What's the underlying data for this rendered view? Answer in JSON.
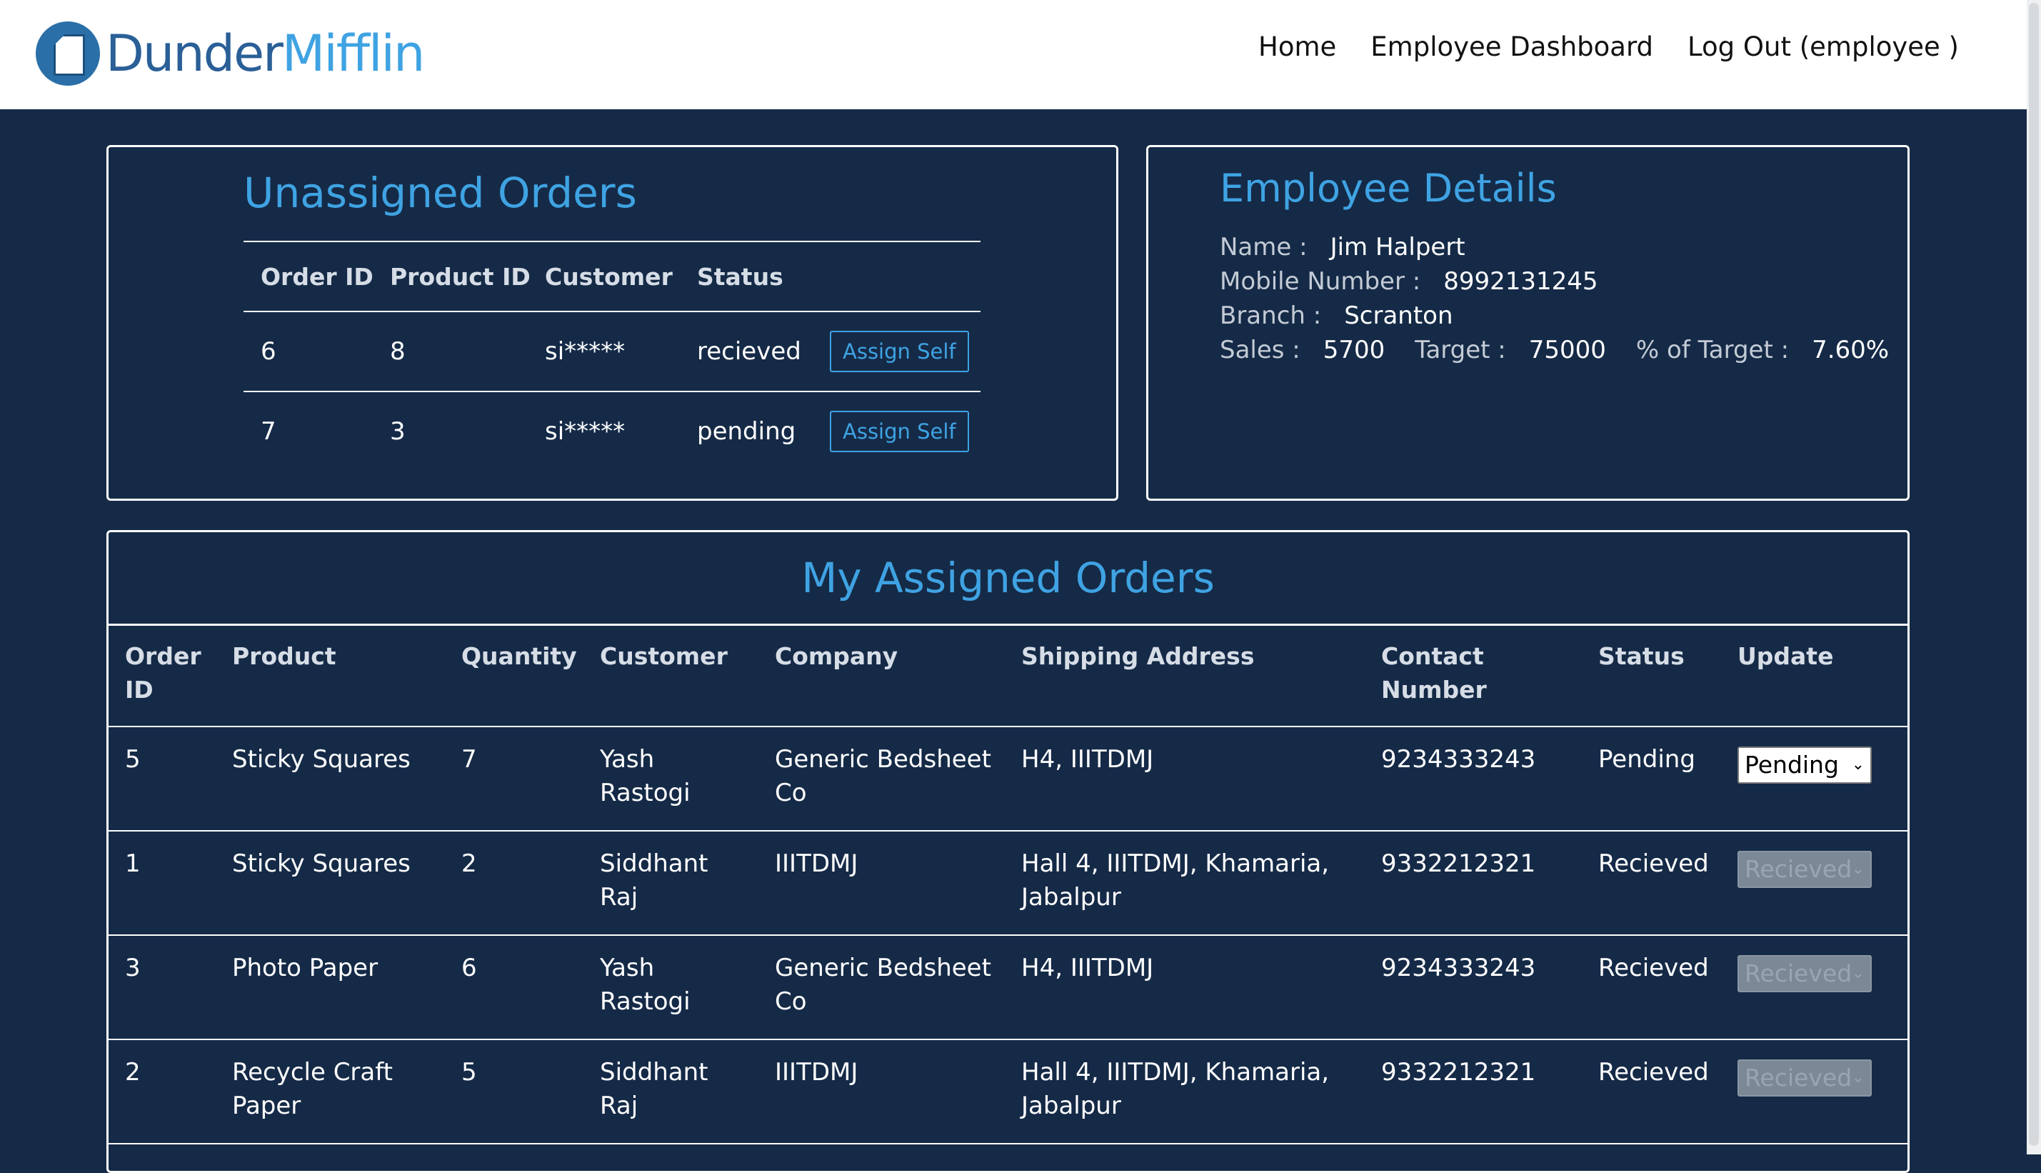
{
  "brand": {
    "part1": "Dunder",
    "part2": "Mifflin"
  },
  "nav": {
    "home": "Home",
    "dashboard": "Employee Dashboard",
    "logout": "Log Out (employee )"
  },
  "unassigned": {
    "title": "Unassigned Orders",
    "headers": [
      "Order ID",
      "Product ID",
      "Customer",
      "Status"
    ],
    "button_label": "Assign Self",
    "rows": [
      {
        "order_id": "6",
        "product_id": "8",
        "customer": "si*****",
        "status": "recieved"
      },
      {
        "order_id": "7",
        "product_id": "3",
        "customer": "si*****",
        "status": "pending"
      }
    ]
  },
  "employee": {
    "title": "Employee Details",
    "name_label": "Name :",
    "name": "Jim Halpert",
    "mobile_label": "Mobile Number :",
    "mobile": "8992131245",
    "branch_label": "Branch :",
    "branch": "Scranton",
    "sales_label": "Sales :",
    "sales": "5700",
    "target_label": "Target :",
    "target": "75000",
    "pct_label": "% of Target :",
    "pct": "7.60%"
  },
  "assigned": {
    "title": "My Assigned Orders",
    "headers": {
      "order_id_1": "Order",
      "order_id_2": "ID",
      "product": "Product",
      "quantity": "Quantity",
      "customer": "Customer",
      "company": "Company",
      "address": "Shipping Address",
      "contact_1": "Contact",
      "contact_2": "Number",
      "status": "Status",
      "update": "Update"
    },
    "rows": [
      {
        "order_id": "5",
        "product_1": "Sticky Squares",
        "product_2": "",
        "quantity": "7",
        "customer_1": "Yash",
        "customer_2": "Rastogi",
        "company_1": "Generic Bedsheet",
        "company_2": "Co",
        "address_1": "H4, IIITDMJ",
        "address_2": "",
        "contact": "9234333243",
        "status": "Pending",
        "update": "Pending"
      },
      {
        "order_id": "1",
        "product_1": "Sticky Squares",
        "product_2": "",
        "quantity": "2",
        "customer_1": "Siddhant",
        "customer_2": "Raj",
        "company_1": "IIITDMJ",
        "company_2": "",
        "address_1": "Hall 4, IIITDMJ, Khamaria,",
        "address_2": "Jabalpur",
        "contact": "9332212321",
        "status": "Recieved",
        "update": "Recieved"
      },
      {
        "order_id": "3",
        "product_1": "Photo Paper",
        "product_2": "",
        "quantity": "6",
        "customer_1": "Yash",
        "customer_2": "Rastogi",
        "company_1": "Generic Bedsheet",
        "company_2": "Co",
        "address_1": "H4, IIITDMJ",
        "address_2": "",
        "contact": "9234333243",
        "status": "Recieved",
        "update": "Recieved"
      },
      {
        "order_id": "2",
        "product_1": "Recycle Craft",
        "product_2": "Paper",
        "quantity": "5",
        "customer_1": "Siddhant",
        "customer_2": "Raj",
        "company_1": "IIITDMJ",
        "company_2": "",
        "address_1": "Hall 4, IIITDMJ, Khamaria,",
        "address_2": "Jabalpur",
        "contact": "9332212321",
        "status": "Recieved",
        "update": "Recieved"
      }
    ]
  }
}
